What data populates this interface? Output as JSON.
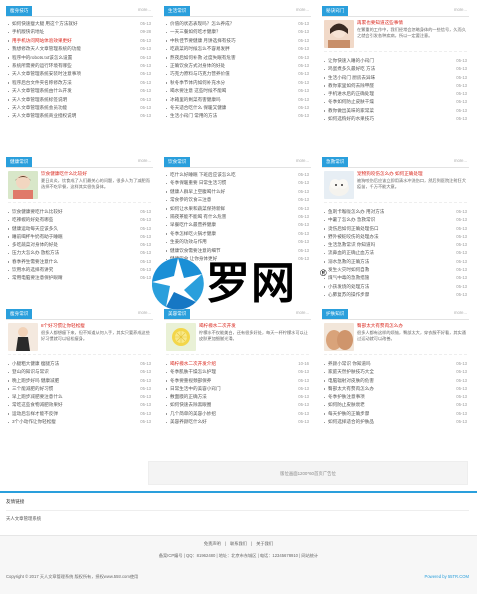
{
  "boxes": [
    {
      "title": "瘦身技巧",
      "more": "more...",
      "items": [
        {
          "t": "如何快速瘦大腿 用这个方法就好",
          "d": "05-13",
          "red": false
        },
        {
          "t": "手机版快讯地址",
          "d": "09-28",
          "red": false
        },
        {
          "t": "用手机访问网站体验效果更好",
          "d": "05-13",
          "red": true
        },
        {
          "t": "我想修改天人文章管理系统的功能",
          "d": "05-13",
          "red": false
        },
        {
          "t": "程序中的robots.txt该怎么设置",
          "d": "05-13",
          "red": false
        },
        {
          "t": "系统所需要的运行环境有哪些",
          "d": "05-13",
          "red": false
        },
        {
          "t": "天人文章管理系统安装时注意事项",
          "d": "05-13",
          "red": false
        },
        {
          "t": "程序后台文件夹名称修改方法",
          "d": "05-13",
          "red": false
        },
        {
          "t": "天人文章管理系统由什么开发",
          "d": "05-13",
          "red": false
        },
        {
          "t": "天人文章管理系统标签说明",
          "d": "05-13",
          "red": false
        },
        {
          "t": "天人文章管理系统会员功能",
          "d": "05-13",
          "red": false
        },
        {
          "t": "天人文章管理系统商业授权说明",
          "d": "05-13",
          "red": false
        }
      ]
    },
    {
      "title": "生活常识",
      "more": "more...",
      "items": [
        {
          "t": "价值的状态表现吗？怎么养成？",
          "d": "05-13",
          "red": false
        },
        {
          "t": "一天三餐如何吃才健康？",
          "d": "05-13",
          "red": false
        },
        {
          "t": "中秋佳节要健康 月饼选择有技巧",
          "d": "05-13",
          "red": false
        },
        {
          "t": "吃蔬菜的时候怎么不容易发胖",
          "d": "05-13",
          "red": false
        },
        {
          "t": "熬夜后如何补救 过度失眠有危害",
          "d": "05-13",
          "red": false
        },
        {
          "t": "正确饮食方式对身体的好处",
          "d": "05-13",
          "red": false
        },
        {
          "t": "巧克力原料与巧克力营养价值",
          "d": "05-13",
          "red": false
        },
        {
          "t": "秋冬季节体内如何补充水分",
          "d": "05-13",
          "red": false
        },
        {
          "t": "喝水要注意 这些时候不能喝",
          "d": "05-13",
          "red": false
        },
        {
          "t": "冰箱里的剩菜有害健康吗",
          "d": "05-13",
          "red": false
        },
        {
          "t": "冬天适合吃什么 保暖又健康",
          "d": "05-13",
          "red": false
        },
        {
          "t": "生活小窍门 常用的方法",
          "d": "05-13",
          "red": false
        }
      ]
    },
    {
      "title": "秘诀窍门",
      "more": "more...",
      "feature": {
        "title": "再累也要知道这些事情",
        "desc": "在繁重的工作中，我们经常会忽略身体的一些信号，久而久之就会引发各种疾病，所以一定要注意。"
      },
      "items": [
        {
          "t": "让你快速入睡的小窍门",
          "d": "05-13",
          "red": false
        },
        {
          "t": "鸡蛋煮多久最好吃 方法",
          "d": "05-13",
          "red": false
        },
        {
          "t": "生活小窍门 厨房去异味",
          "d": "05-13",
          "red": false
        },
        {
          "t": "教你家里如何去除甲醛",
          "d": "05-13",
          "red": false
        },
        {
          "t": "手机进水后的正确处理",
          "d": "05-13",
          "red": false
        },
        {
          "t": "冬季如何防止皮肤干燥",
          "d": "05-13",
          "red": false
        },
        {
          "t": "教你做出美味的家常菜",
          "d": "05-13",
          "red": false
        },
        {
          "t": "如何选购好的水果技巧",
          "d": "05-13",
          "red": false
        }
      ]
    },
    {
      "title": "健康常识",
      "more": "more...",
      "feature": {
        "title": "饮食健康吃什么比较好",
        "desc": "夏日炎炎，饮食成了人们最关心的问题，很多人为了减肥而选择不吃早餐，这样其实很伤身体。"
      },
      "items": [
        {
          "t": "饮食健康要吃什么比较好",
          "d": "05-13",
          "red": false
        },
        {
          "t": "吃辣椒的好处有哪些",
          "d": "05-13",
          "red": false
        },
        {
          "t": "健康运动每天应该多久",
          "d": "05-13",
          "red": false
        },
        {
          "t": "睡前喝杯牛奶有助于睡眠",
          "d": "05-13",
          "red": false
        },
        {
          "t": "多吃蔬菜对身体的好处",
          "d": "05-13",
          "red": false
        },
        {
          "t": "压力大怎么办 放松方法",
          "d": "05-13",
          "red": false
        },
        {
          "t": "春季养生需要注意什么",
          "d": "05-13",
          "red": false
        },
        {
          "t": "饮用水的选择有讲究",
          "d": "05-13",
          "red": false
        },
        {
          "t": "常用电脑要注意保护眼睛",
          "d": "05-13",
          "red": false
        }
      ]
    },
    {
      "title": "饮食常识",
      "more": "more...",
      "items": [
        {
          "t": "吃什么好睡眠 下班后应该怎么吃",
          "d": "05-13",
          "red": false
        },
        {
          "t": "冬季保暖重要 日常生活习惯",
          "d": "05-13",
          "red": false
        },
        {
          "t": "健康人群早上空腹喝什么好",
          "d": "05-13",
          "red": false
        },
        {
          "t": "常食参的饮食三注意",
          "d": "05-13",
          "red": false
        },
        {
          "t": "如何让水果和蔬菜保持新鲜",
          "d": "05-13",
          "red": false
        },
        {
          "t": "隔夜茶能不能喝 有什么危害",
          "d": "05-13",
          "red": false
        },
        {
          "t": "早餐吃什么最营养健康",
          "d": "05-13",
          "red": false
        },
        {
          "t": "冬季怎样吃火锅才健康",
          "d": "05-13",
          "red": false
        },
        {
          "t": "生姜的功效与作用",
          "d": "05-13",
          "red": false
        },
        {
          "t": "健康饮食需要注意的细节",
          "d": "05-13",
          "red": false
        },
        {
          "t": "健康饮食 让你身体更好",
          "d": "05-13",
          "red": false
        }
      ]
    },
    {
      "title": "急救常识",
      "more": "more...",
      "feature": {
        "title": "宠物狗咬伤怎么办 如何正确处理",
        "desc": "被狗咬伤后应该立即用清水冲洗伤口，然后到医院注射狂犬疫苗，千万不能大意。"
      },
      "items": [
        {
          "t": "鱼刺卡喉咙怎么办 用对方法",
          "d": "05-13",
          "red": false
        },
        {
          "t": "中暑了怎么办 急救常识",
          "d": "05-13",
          "red": false
        },
        {
          "t": "烫伤后如何正确处理伤口",
          "d": "05-13",
          "red": false
        },
        {
          "t": "野外被蛇咬伤的处理办法",
          "d": "05-13",
          "red": false
        },
        {
          "t": "生活急救常识 你知道吗",
          "d": "05-13",
          "red": false
        },
        {
          "t": "流鼻血的正确止血方法",
          "d": "05-13",
          "red": false
        },
        {
          "t": "溺水急救的正确方法",
          "d": "05-13",
          "red": false
        },
        {
          "t": "发生火灾时如何自救",
          "d": "05-13",
          "red": false
        },
        {
          "t": "煤气中毒的急救措施",
          "d": "05-13",
          "red": false
        },
        {
          "t": "小孩发烧的处理方法",
          "d": "05-13",
          "red": false
        },
        {
          "t": "心肺复苏的操作步骤",
          "d": "05-13",
          "red": false
        }
      ]
    },
    {
      "title": "瘦身常识",
      "more": "more...",
      "feature": {
        "title": "8个好习惯让你轻松瘦",
        "desc": "很多人都想瘦下来，但不知道从何入手，其实只要养成这些好习惯就可以轻松瘦身。"
      },
      "items": [
        {
          "t": "小腿粗大健康 瘦腿方法",
          "d": "05-13",
          "red": false
        },
        {
          "t": "登山的知识与常识",
          "d": "05-13",
          "red": false
        },
        {
          "t": "晚上跑步好吗 健康减肥",
          "d": "05-13",
          "red": false
        },
        {
          "t": "三个能减肥的好习惯",
          "d": "05-13",
          "red": false
        },
        {
          "t": "早上跑步减肥要注意什么",
          "d": "05-13",
          "red": false
        },
        {
          "t": "常吃这些食物减肥效果好",
          "d": "05-13",
          "red": false
        },
        {
          "t": "运动后怎样才能不反弹",
          "d": "05-13",
          "red": false
        },
        {
          "t": "3个小动作让你轻松瘦",
          "d": "05-13",
          "red": false
        }
      ]
    },
    {
      "title": "美容常识",
      "more": "more...",
      "feature": {
        "title": "喝柠檬水二次开发",
        "desc": "柠檬水不仅能美白，还有很多好处，每天一杯柠檬水可以让皮肤更加细腻光滑。"
      },
      "items": [
        {
          "t": "喝柠檬水二次开发介绍",
          "d": "10-16",
          "red": true
        },
        {
          "t": "冬季肌肤干燥怎么护理",
          "d": "05-13",
          "red": false
        },
        {
          "t": "冬季要重视颈部保养",
          "d": "05-13",
          "red": false
        },
        {
          "t": "日常生活中的美容小窍门",
          "d": "05-13",
          "red": false
        },
        {
          "t": "敷面膜的正确方法",
          "d": "05-13",
          "red": false
        },
        {
          "t": "如何快速去除黑眼圈",
          "d": "05-13",
          "red": false
        },
        {
          "t": "几个简单的美容小妙招",
          "d": "05-13",
          "red": false
        },
        {
          "t": "美容养颜吃什么好",
          "d": "05-13",
          "red": false
        }
      ]
    },
    {
      "title": "护肤知识",
      "more": "more...",
      "feature": {
        "title": "臀部太大有赘肉怎么办",
        "desc": "很多人都有这样的烦恼，臀部太大，穿衣服不好看，其实通过运动就可以改善。"
      },
      "items": [
        {
          "t": "养颜小常识 你知道吗",
          "d": "05-13",
          "red": false
        },
        {
          "t": "家庭天然护肤技巧大全",
          "d": "05-13",
          "red": false
        },
        {
          "t": "电脑辐射对皮肤的危害",
          "d": "05-13",
          "red": false
        },
        {
          "t": "臀部太大有赘肉怎么办",
          "d": "05-13",
          "red": false
        },
        {
          "t": "冬季护肤注意事项",
          "d": "05-13",
          "red": false
        },
        {
          "t": "如何防止皮肤衰老",
          "d": "05-13",
          "red": false
        },
        {
          "t": "每天护肤的正确步骤",
          "d": "05-13",
          "red": false
        },
        {
          "t": "如何选择适合的护肤品",
          "d": "05-13",
          "red": false
        }
      ]
    }
  ],
  "banner": {
    "text": "版位画面1200*60首页广告位"
  },
  "friends": {
    "title": "友情链接",
    "link": "天人文章管理系统"
  },
  "footer": {
    "links": [
      "免责声明",
      "联系我们",
      "关于我们"
    ],
    "info": "备案ICP编号 | QQ：81962480 | 地址：北京市东城区 | 电话：12345678910 | 网站统计",
    "copy": "Copyright © 2017 天人文章管理系统 版权所有，授权www.55tr.com使用",
    "powered": "Powered by 55TR.COM"
  },
  "watermark": {
    "text": "罗网",
    "reg": "®"
  },
  "colors": {
    "accent": "#2a9fdc",
    "red": "#d9261c"
  }
}
